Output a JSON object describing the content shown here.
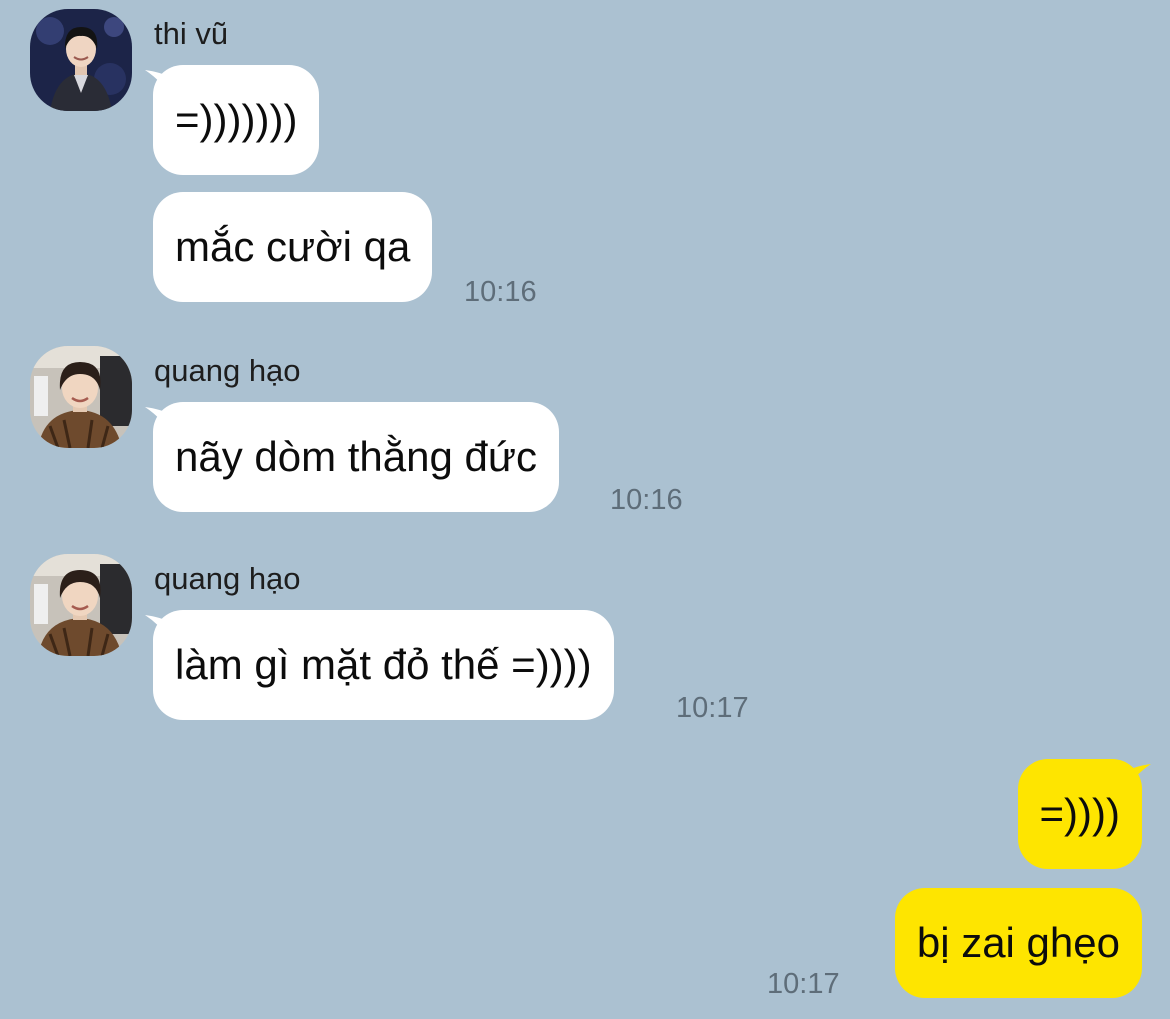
{
  "chat": {
    "groups": [
      {
        "sender": "thi vũ",
        "avatar": "avatar-thi-vu",
        "messages": [
          "=)))))))",
          "mắc cười qa"
        ],
        "time": "10:16"
      },
      {
        "sender": "quang hạo",
        "avatar": "avatar-quang-hao",
        "messages": [
          "nãy dòm thằng đức"
        ],
        "time": "10:16"
      },
      {
        "sender": "quang hạo",
        "avatar": "avatar-quang-hao",
        "messages": [
          "làm gì mặt đỏ thế =))))"
        ],
        "time": "10:17"
      },
      {
        "sender": "me",
        "messages": [
          "=))))",
          "bị zai ghẹo"
        ],
        "time": "10:17"
      }
    ]
  },
  "colors": {
    "background": "#abc1d1",
    "incoming_bubble": "#ffffff",
    "outgoing_bubble": "#fee500",
    "timestamp": "#5e6d79"
  }
}
